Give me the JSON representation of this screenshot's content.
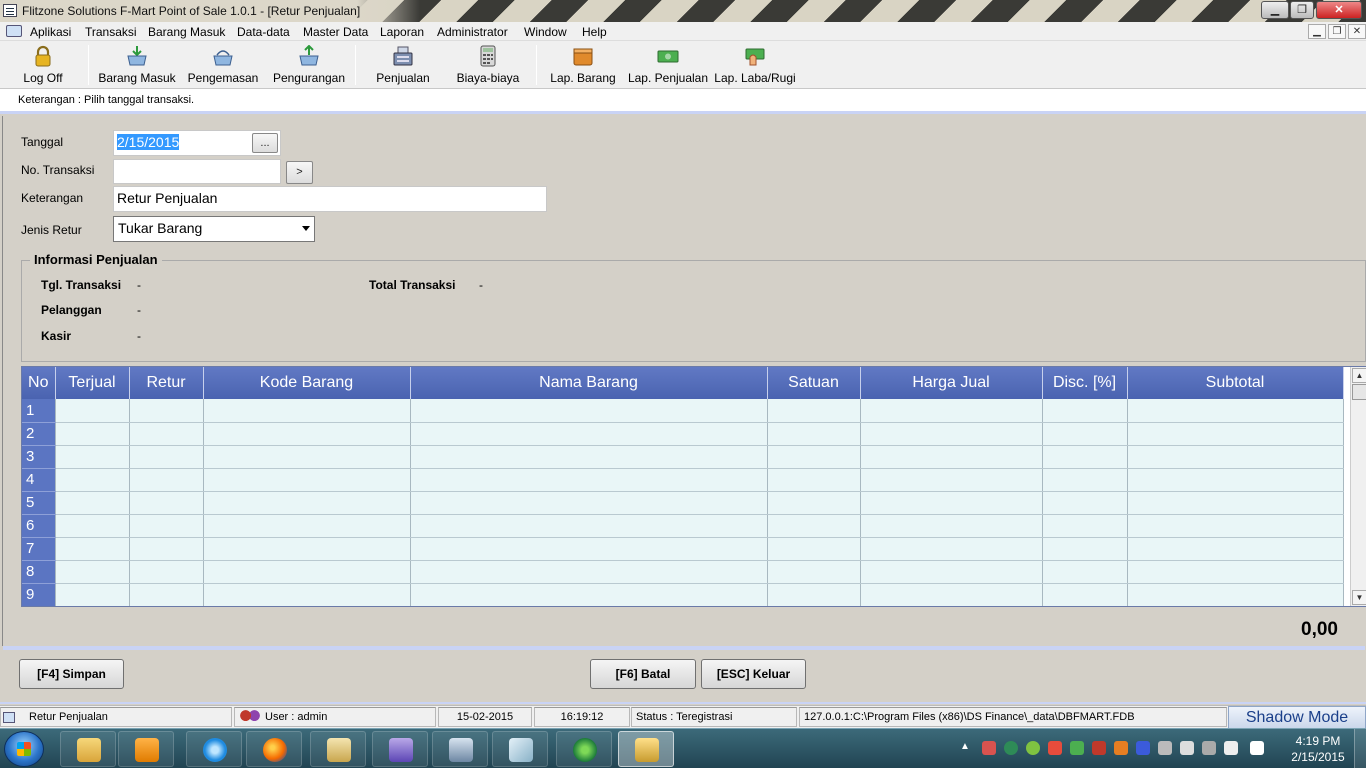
{
  "window": {
    "title": "Flitzone Solutions F-Mart Point of Sale 1.0.1     - [Retur Penjualan]"
  },
  "menu": [
    "Aplikasi",
    "Transaksi",
    "Barang Masuk",
    "Data-data",
    "Master Data",
    "Laporan",
    "Administrator",
    "Window",
    "Help"
  ],
  "toolbar": {
    "log_off": "Log Off",
    "barang_masuk": "Barang Masuk",
    "pengemasan": "Pengemasan",
    "pengurangan": "Pengurangan",
    "penjualan": "Penjualan",
    "biaya": "Biaya-biaya",
    "lap_barang": "Lap. Barang",
    "lap_penjualan": "Lap. Penjualan",
    "lap_laba": "Lap. Laba/Rugi"
  },
  "info": "Keterangan : Pilih tanggal transaksi.",
  "form": {
    "tanggal_label": "Tanggal",
    "tanggal_value": "2/15/2015",
    "date_button": "...",
    "no_transaksi_label": "No. Transaksi",
    "no_transaksi_value": "",
    "go_button": ">",
    "keterangan_label": "Keterangan",
    "keterangan_value": "Retur Penjualan",
    "jenis_retur_label": "Jenis Retur",
    "jenis_retur_value": "Tukar Barang"
  },
  "info_penjualan": {
    "title": "Informasi Penjualan",
    "tgl_label": "Tgl. Transaksi",
    "tgl_value": "-",
    "total_label": "Total Transaksi",
    "total_value": "-",
    "pelanggan_label": "Pelanggan",
    "pelanggan_value": "-",
    "kasir_label": "Kasir",
    "kasir_value": "-"
  },
  "grid": {
    "columns": [
      "No",
      "Terjual",
      "Retur",
      "Kode Barang",
      "Nama Barang",
      "Satuan",
      "Harga Jual",
      "Disc. [%]",
      "Subtotal"
    ],
    "rows": [
      "1",
      "2",
      "3",
      "4",
      "5",
      "6",
      "7",
      "8",
      "9"
    ]
  },
  "total": "0,00",
  "buttons": {
    "simpan": "[F4] Simpan",
    "batal": "[F6] Batal",
    "keluar": "[ESC] Keluar"
  },
  "status": {
    "form": "Retur Penjualan",
    "user": "User : admin",
    "date": "15-02-2015",
    "time": "16:19:12",
    "reg": "Status : Teregistrasi",
    "db": "127.0.0.1:C:\\Program Files (x86)\\DS Finance\\_data\\DBFMART.FDB",
    "shadow": "Shadow Mode"
  },
  "taskbar": {
    "time": "4:19 PM",
    "date": "2/15/2015"
  }
}
